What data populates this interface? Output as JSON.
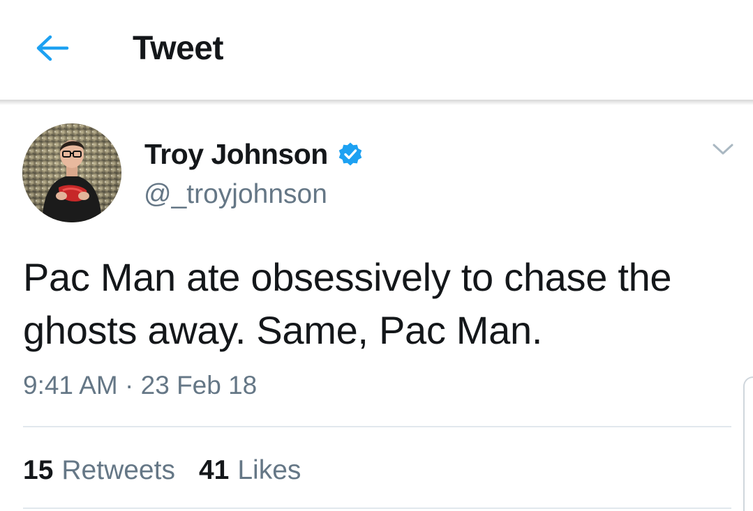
{
  "header": {
    "title": "Tweet",
    "back_icon": "arrow-left-icon"
  },
  "author": {
    "name": "Troy Johnson",
    "handle": "@_troyjohnson",
    "verified": true,
    "verified_icon": "verified-badge-icon"
  },
  "tweet": {
    "text": "Pac Man ate obsessively to chase the ghosts away. Same, Pac Man.",
    "timestamp": "9:41 AM · 23 Feb 18"
  },
  "stats": {
    "retweets_count": "15",
    "retweets_label": "Retweets",
    "likes_count": "41",
    "likes_label": "Likes"
  },
  "colors": {
    "accent": "#1da1f2",
    "text_primary": "#14171a",
    "text_secondary": "#657786",
    "divider": "#e1e8ed"
  }
}
